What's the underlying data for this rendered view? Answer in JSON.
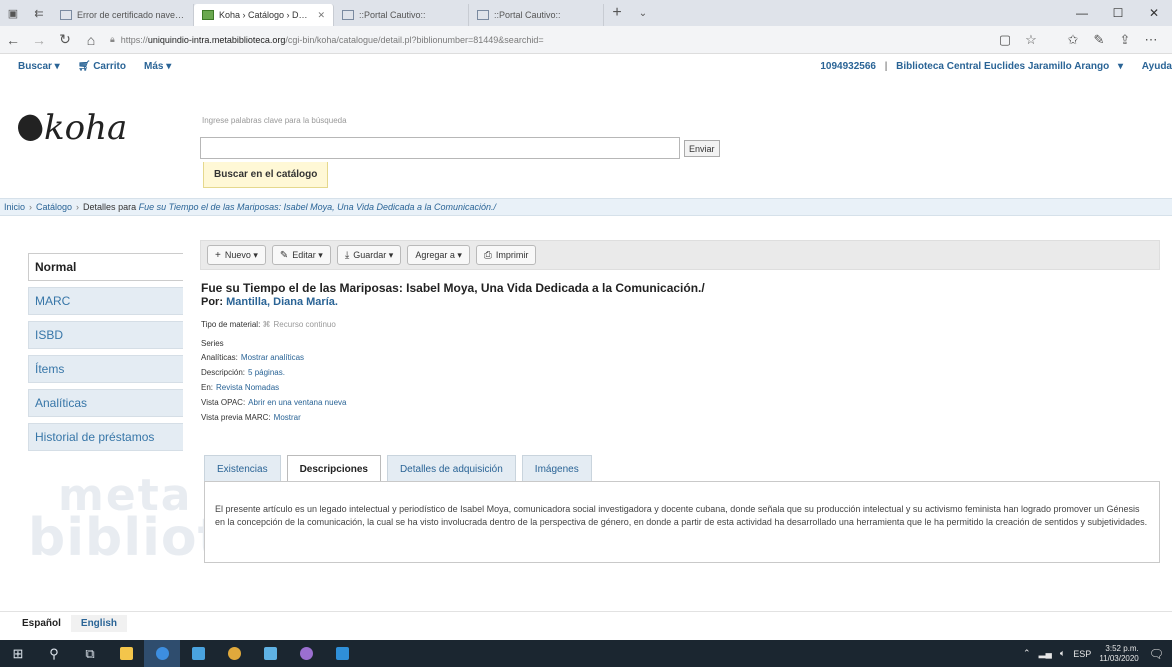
{
  "browser": {
    "tabs": [
      {
        "label": "Error de certificado navega",
        "active": false
      },
      {
        "label": "Koha › Catálogo › Detall",
        "active": true
      },
      {
        "label": "::Portal Cautivo::",
        "active": false
      },
      {
        "label": "::Portal Cautivo::",
        "active": false
      }
    ],
    "url_prefix": "https://",
    "url_host": "uniquindio-intra.metabiblioteca.org",
    "url_path": "/cgi-bin/koha/catalogue/detail.pl?biblionumber=81449&searchid="
  },
  "koha_nav": {
    "search": "Buscar",
    "cart": "Carrito",
    "more": "Más",
    "user": "1094932566",
    "separator": "|",
    "library": "Biblioteca Central Euclides Jaramillo Arango",
    "help": "Ayuda"
  },
  "logo": {
    "text": "koha"
  },
  "search": {
    "hint": "Ingrese palabras clave para la búsqueda",
    "value": "",
    "submit": "Enviar",
    "tab": "Buscar en el catálogo"
  },
  "breadcrumb": {
    "home": "Inicio",
    "catalog": "Catálogo",
    "details_prefix": "Detalles para",
    "details_title": "Fue su Tiempo el de las Mariposas: Isabel Moya, Una Vida Dedicada a la Comunicación./"
  },
  "left_menu": [
    "Normal",
    "MARC",
    "ISBD",
    "Ítems",
    "Analíticas",
    "Historial de préstamos"
  ],
  "watermark": {
    "line1": "meta",
    "line2": "biblioteca"
  },
  "toolbar": {
    "new": "Nuevo",
    "edit": "Editar",
    "save": "Guardar",
    "add": "Agregar a",
    "print": "Imprimir"
  },
  "record": {
    "title": "Fue su Tiempo el de las Mariposas: Isabel Moya, Una Vida Dedicada a la Comunicación./",
    "author_label": "Por:",
    "author": "Mantilla, Diana María.",
    "fields": [
      {
        "label": "Tipo de material:",
        "value": "Recurso continuo",
        "grey": true
      },
      {
        "label": "Series",
        "value": "",
        "grey": false
      },
      {
        "label": "Analíticas:",
        "value": "Mostrar analíticas",
        "grey": false
      },
      {
        "label": "Descripción:",
        "value": "5 páginas.",
        "grey": false
      },
      {
        "label": "En:",
        "value": "Revista Nomadas",
        "grey": false
      },
      {
        "label": "Vista OPAC:",
        "value": "Abrir en una ventana nueva",
        "grey": false
      },
      {
        "label": "Vista previa MARC:",
        "value": "Mostrar",
        "grey": false
      }
    ]
  },
  "tabs": [
    "Existencias",
    "Descripciones",
    "Detalles de adquisición",
    "Imágenes"
  ],
  "description": "El presente artículo es un legado intelectual y periodístico de Isabel Moya, comunicadora social investigadora y docente cubana, donde señala que su producción intelectual y su activismo feminista han logrado promover un Génesis en la concepción de la comunicación, la cual se ha visto involucrada dentro de la perspectiva de género, en donde a partir de esta actividad ha desarrollado una herramienta que le ha permitido la creación de sentidos y subjetividades.",
  "languages": [
    "Español",
    "English"
  ],
  "taskbar": {
    "lang": "ESP",
    "time": "3:52 p.m.",
    "date": "11/03/2020"
  }
}
